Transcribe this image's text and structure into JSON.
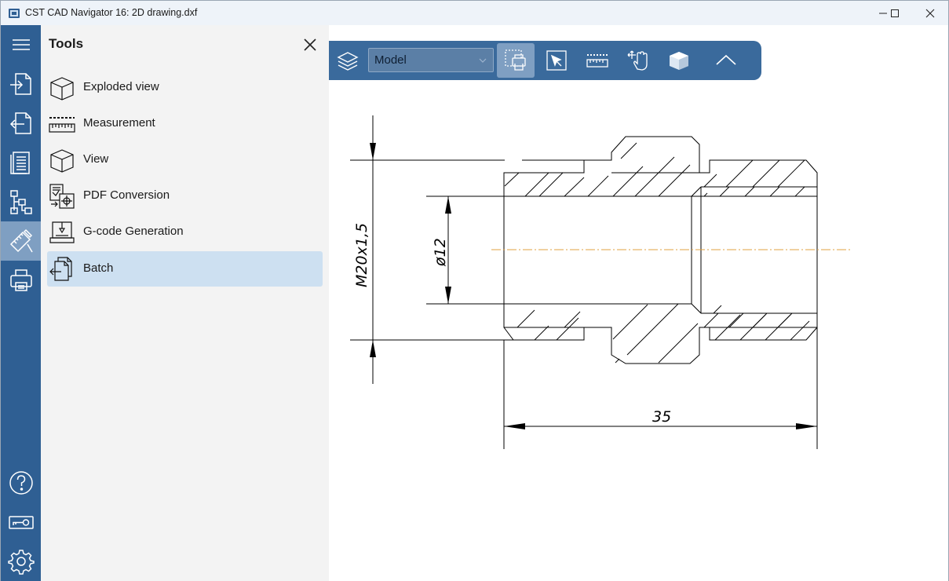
{
  "window": {
    "title": "CST CAD Navigator 16: 2D drawing.dxf"
  },
  "rail": {
    "icons": [
      "menu-icon",
      "import-icon",
      "export-icon",
      "document-icon",
      "hierarchy-icon",
      "tools-icon",
      "print-icon",
      "help-icon",
      "license-key-icon",
      "settings-icon"
    ]
  },
  "panel": {
    "title": "Tools",
    "items": [
      {
        "label": "Exploded view",
        "icon": "exploded-view-icon"
      },
      {
        "label": "Measurement",
        "icon": "measurement-icon"
      },
      {
        "label": "View",
        "icon": "view-cube-icon"
      },
      {
        "label": "PDF Conversion",
        "icon": "pdf-conversion-icon"
      },
      {
        "label": "G-code Generation",
        "icon": "gcode-icon"
      },
      {
        "label": "Batch",
        "icon": "batch-icon",
        "selected": true
      }
    ]
  },
  "toolbar": {
    "layout_value": "Model",
    "buttons": [
      "layers-icon",
      "print-area-icon",
      "select-icon",
      "ruler-icon",
      "pan-icon",
      "view-3d-icon",
      "collapse-icon"
    ]
  },
  "drawing": {
    "dim_thread": "M20x1,5",
    "dim_bore": "ø12",
    "dim_length": "35"
  },
  "colors": {
    "rail": "#2f5f93",
    "toolbar": "#3a6a9c",
    "selected_item": "#cde0f1",
    "centerline": "#e0a040"
  }
}
